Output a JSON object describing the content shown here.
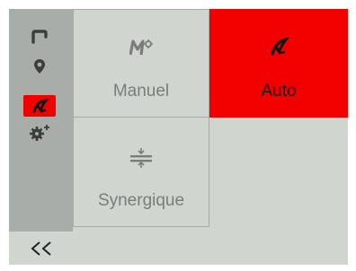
{
  "sidebar": {
    "icons": [
      {
        "name": "torch-icon"
      },
      {
        "name": "location-pin-icon"
      },
      {
        "name": "auto-mode-icon",
        "active": true
      },
      {
        "name": "gear-plus-icon"
      }
    ],
    "back_label": "<<"
  },
  "modes": [
    {
      "label": "Manuel",
      "icon": "manual-mode-icon",
      "selected": false
    },
    {
      "label": "Auto",
      "icon": "auto-mode-icon",
      "selected": true
    },
    {
      "label": "Synergique",
      "icon": "synergic-mode-icon",
      "selected": false
    }
  ],
  "colors": {
    "accent": "#f20000",
    "panel": "#d0d5d0",
    "sidebar": "#a9ada9",
    "icon_gray": "#7a7d7a",
    "dark": "#141414"
  }
}
